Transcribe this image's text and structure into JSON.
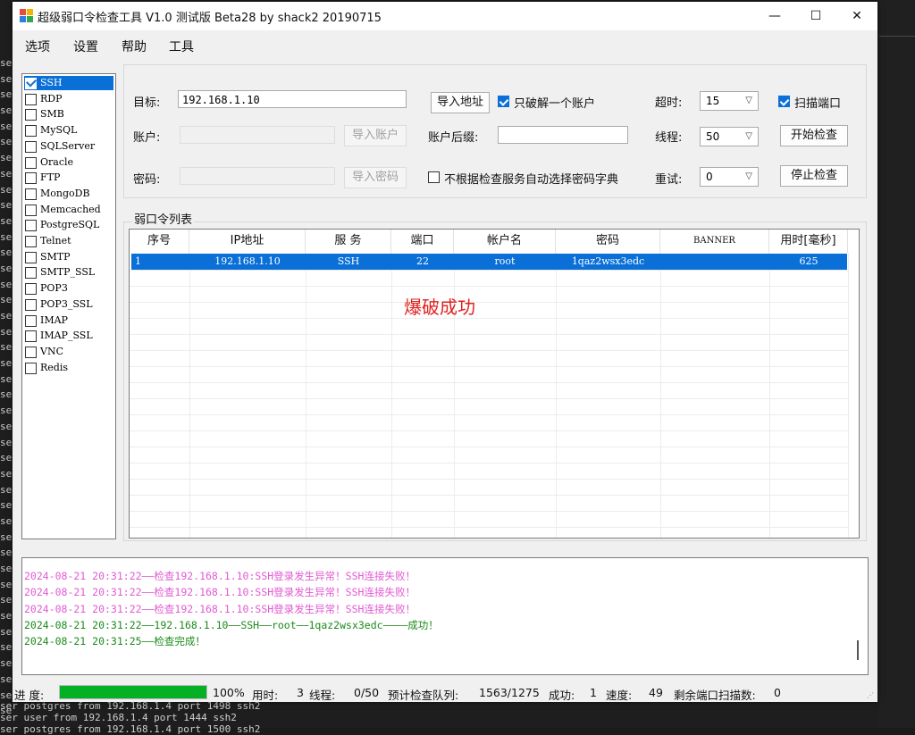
{
  "background_terminal": {
    "left_fragments": [
      "se",
      "se",
      "se",
      "se",
      "se",
      "se",
      "se",
      "se",
      "se",
      "se",
      "se",
      "se",
      "se",
      "se",
      "se",
      "se",
      "se",
      "se",
      "se",
      "se",
      "se",
      "se",
      "se",
      "se",
      "se",
      "se",
      "se",
      "se",
      "se",
      "se",
      "se",
      "se",
      "se",
      "se",
      "se",
      "se",
      "se",
      "se",
      "se",
      "se",
      "se",
      "se"
    ],
    "bottom_lines": [
      "ser postgres from 192.168.1.4 port 1498 ssh2",
      "ser user from 192.168.1.4 port 1444 ssh2",
      "ser postgres from 192.168.1.4 port 1500 ssh2"
    ]
  },
  "window": {
    "title": "超级弱口令检查工具 V1.0 测试版 Beta28 by shack2 20190715",
    "minimize_glyph": "—",
    "maximize_glyph": "☐",
    "close_glyph": "✕",
    "menu": [
      "选项",
      "设置",
      "帮助",
      "工具"
    ]
  },
  "protocols": [
    {
      "name": "SSH",
      "checked": true,
      "selected": true
    },
    {
      "name": "RDP",
      "checked": false
    },
    {
      "name": "SMB",
      "checked": false
    },
    {
      "name": "MySQL",
      "checked": false
    },
    {
      "name": "SQLServer",
      "checked": false
    },
    {
      "name": "Oracle",
      "checked": false
    },
    {
      "name": "FTP",
      "checked": false
    },
    {
      "name": "MongoDB",
      "checked": false
    },
    {
      "name": "Memcached",
      "checked": false
    },
    {
      "name": "PostgreSQL",
      "checked": false
    },
    {
      "name": "Telnet",
      "checked": false
    },
    {
      "name": "SMTP",
      "checked": false
    },
    {
      "name": "SMTP_SSL",
      "checked": false
    },
    {
      "name": "POP3",
      "checked": false
    },
    {
      "name": "POP3_SSL",
      "checked": false
    },
    {
      "name": "IMAP",
      "checked": false
    },
    {
      "name": "IMAP_SSL",
      "checked": false
    },
    {
      "name": "VNC",
      "checked": false
    },
    {
      "name": "Redis",
      "checked": false
    }
  ],
  "settings": {
    "target_label": "目标:",
    "target_value": "192.168.1.10",
    "account_label": "账户:",
    "password_label": "密码:",
    "import_address": "导入地址",
    "import_account": "导入账户",
    "import_password": "导入密码",
    "only_one_account": "只破解一个账户",
    "only_one_account_checked": true,
    "suffix_label": "账户后缀:",
    "suffix_value": "",
    "auto_dict_label": "不根据检查服务自动选择密码字典",
    "auto_dict_checked": false,
    "timeout_label": "超时:",
    "timeout_value": "15",
    "threads_label": "线程:",
    "threads_value": "50",
    "retry_label": "重试:",
    "retry_value": "0",
    "scan_port_label": "扫描端口",
    "scan_port_checked": true,
    "start_button": "开始检查",
    "stop_button": "停止检查"
  },
  "results": {
    "group_title": "弱口令列表",
    "columns": [
      "序号",
      "IP地址",
      "服 务",
      "端口",
      "帐户名",
      "密码",
      "BANNER",
      "用时[毫秒]"
    ],
    "rows": [
      {
        "index": "1",
        "ip": "192.168.1.10",
        "service": "SSH",
        "port": "22",
        "account": "root",
        "password": "1qaz2wsx3edc",
        "banner": "",
        "time_ms": "625"
      }
    ],
    "overlay_text": "爆破成功"
  },
  "log": {
    "lines": [
      {
        "text": "2024-08-21 20:31:22——检查192.168.1.10:SSH登录发生异常！SSH连接失败！",
        "color": "#e05ad2"
      },
      {
        "text": "2024-08-21 20:31:22——检查192.168.1.10:SSH登录发生异常！SSH连接失败！",
        "color": "#e05ad2"
      },
      {
        "text": "2024-08-21 20:31:22——检查192.168.1.10:SSH登录发生异常！SSH连接失败！",
        "color": "#e05ad2"
      },
      {
        "text": "2024-08-21 20:31:22——192.168.1.10——SSH——root——1qaz2wsx3edc————成功！",
        "color": "#1a8a1a"
      },
      {
        "text": "2024-08-21 20:31:25——检查完成！",
        "color": "#1a8a1a"
      }
    ]
  },
  "status": {
    "progress_label": "进 度:",
    "progress_percent": 100,
    "progress_text": "100%",
    "elapsed_label": "用时:",
    "elapsed_value": "3",
    "threads_label": "线程:",
    "threads_value": "0/50",
    "queue_label": "预计检查队列:",
    "queue_value": "1563/1275",
    "success_label": "成功:",
    "success_value": "1",
    "speed_label": "速度:",
    "speed_value": "49",
    "remaining_label": "剩余端口扫描数:",
    "remaining_value": "0"
  },
  "colors": {
    "selection": "#0a6fd6",
    "progress_fill": "#06b025",
    "overlay_red": "#e02020"
  }
}
